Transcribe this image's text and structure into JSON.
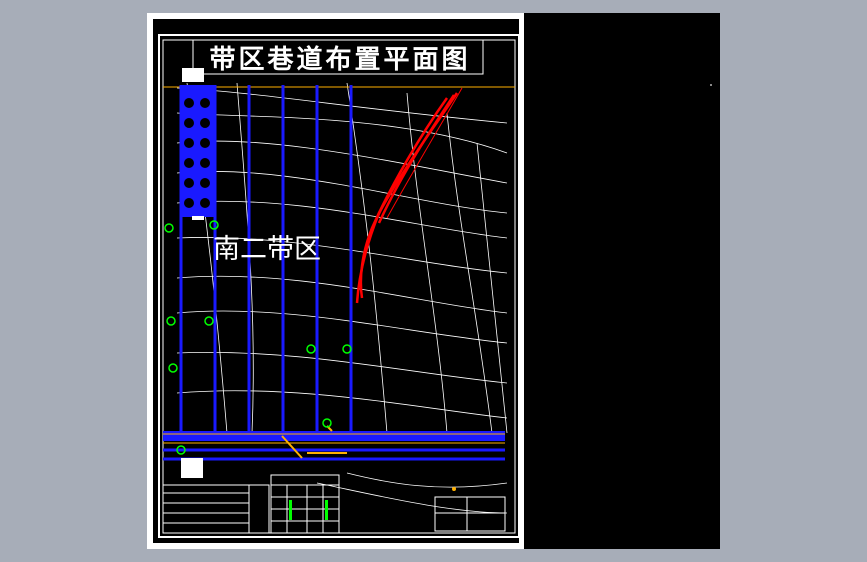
{
  "drawing": {
    "title": "带区巷道布置平面图",
    "region_label": "南二带区"
  },
  "colors": {
    "background": "#a7adb8",
    "viewport": "#000000",
    "paper": "#ffffff",
    "roadway": "#1a1aff",
    "contour": "#ffffff",
    "fault": "#ff0000",
    "marker": "#00ff00",
    "highlight": "#ffb000"
  },
  "icons": [
    "marker-symbol-icon",
    "north-arrow-icon"
  ]
}
